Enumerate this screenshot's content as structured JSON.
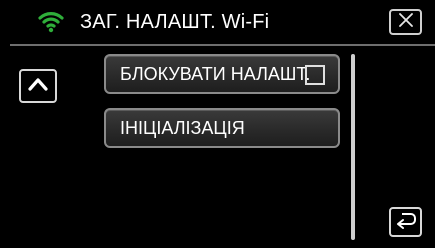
{
  "header": {
    "title": "ЗАГ. НАЛАШТ. Wi-Fi",
    "icon": "wifi-icon",
    "accent_color": "#2fae3a"
  },
  "toolbar": {
    "close_icon": "close-icon",
    "scroll_up_icon": "chevron-up-icon",
    "back_icon": "return-icon"
  },
  "menu": {
    "items": [
      {
        "label": "БЛОКУВАТИ НАЛАШТ.",
        "checkbox": true,
        "checked": false
      },
      {
        "label": "ІНІЦІАЛІЗАЦІЯ"
      }
    ]
  }
}
